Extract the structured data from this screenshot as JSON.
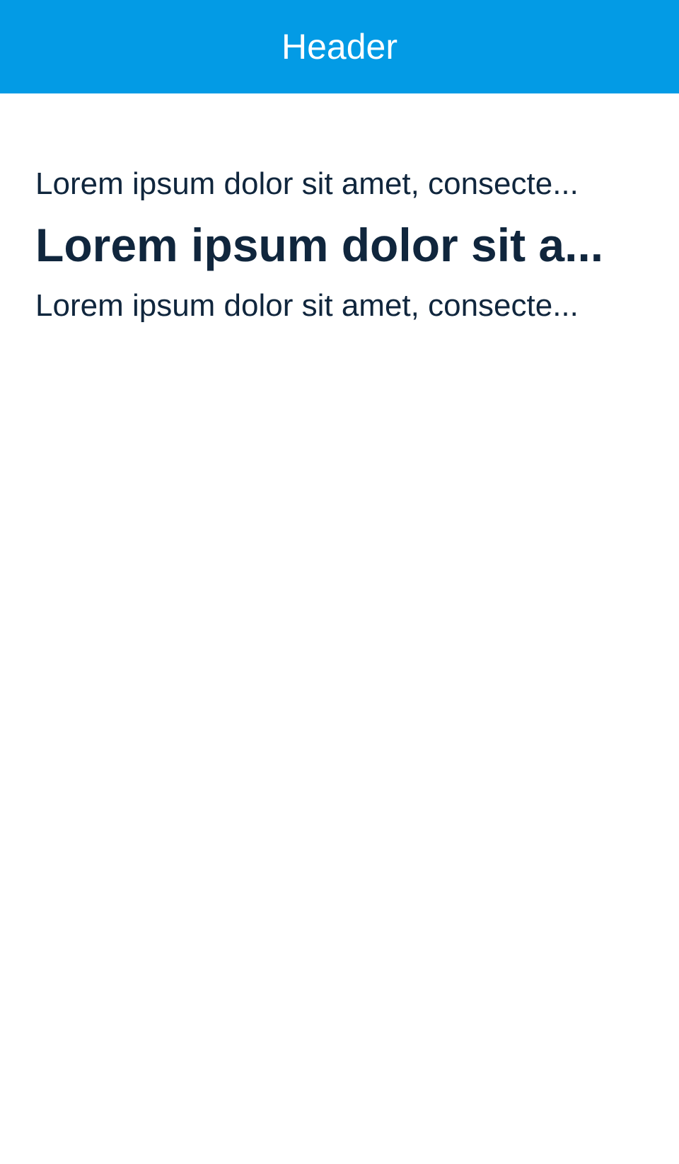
{
  "header": {
    "title": "Header"
  },
  "content": {
    "line_1": "Lorem ipsum dolor sit amet, consecte...",
    "heading": "Lorem ipsum dolor sit a...",
    "line_2": "Lorem ipsum dolor sit amet, consecte..."
  },
  "colors": {
    "header_background": "#039be5",
    "text": "#10263d",
    "header_text": "#ffffff",
    "page_background": "#ffffff"
  }
}
